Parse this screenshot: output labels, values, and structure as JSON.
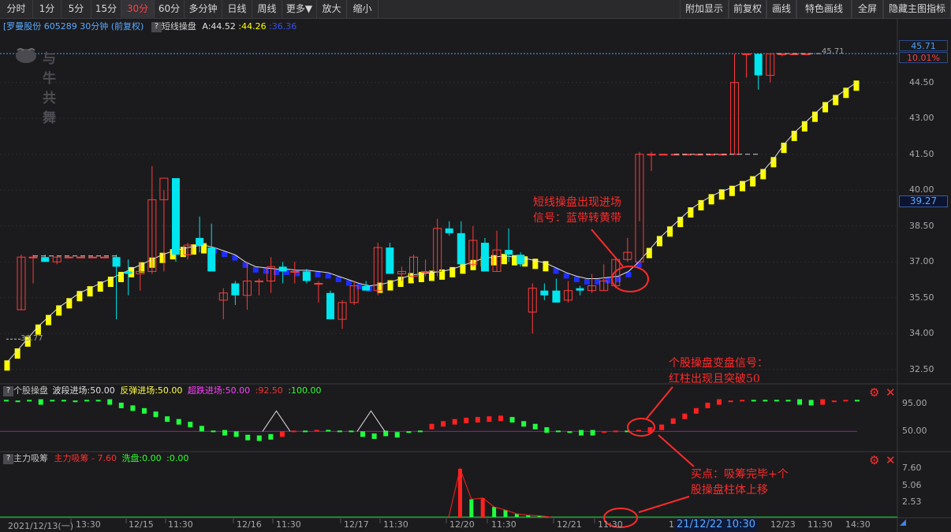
{
  "toolbar": {
    "left": [
      "分时",
      "1分",
      "5分",
      "15分",
      "30分",
      "60分",
      "多分钟",
      "日线",
      "周线",
      "更多▼",
      "放大",
      "缩小"
    ],
    "right": [
      "附加显示",
      "前复权",
      "画线",
      "特色画线",
      "全屏",
      "隐藏主图指标"
    ],
    "active": "30分"
  },
  "main_header": {
    "stock": "[罗曼股份 605289 30分钟 (前复权)",
    "indicator": "短线操盘",
    "a_value": "A:44.52",
    "yellow_value": ":44.26",
    "blue_value": ":36.36"
  },
  "logo_text": "与牛共舞",
  "price_axis": {
    "ticks": [
      "45.71",
      "44.50",
      "43.00",
      "41.50",
      "40.00",
      "38.50",
      "37.00",
      "35.50",
      "34.00",
      "32.50"
    ],
    "top_price": "45.71",
    "top_pct": "10.01%",
    "current": "39.27",
    "prev_close_marker": "33.77",
    "high_marker": "45.71"
  },
  "sub1_header": {
    "name": "个股操盘",
    "l1": "波段进场:50.00",
    "l2": "反弹进场:50.00",
    "l3": "超跌进场:50.00",
    "l4": ":92.50",
    "l5": ":100.00",
    "ticks": [
      "95.00",
      "50.00"
    ]
  },
  "sub2_header": {
    "name": "主力吸筹",
    "l1": "主力吸筹 - 7.60",
    "l2": "洗盘:0.00",
    "l3": ":0.00",
    "ticks": [
      "7.60",
      "5.06",
      "2.53"
    ]
  },
  "time_axis": [
    "2021/12/13(一)",
    "13:30",
    "12/15",
    "11:30",
    "12/16",
    "11:30",
    "12/17",
    "11:30",
    "12/20",
    "11:30",
    "12/21",
    "11:30",
    "12",
    "12/23",
    "11:30",
    "14:30"
  ],
  "time_highlight": "21/12/22 10:30",
  "annotations": {
    "a1_line1": "短线操盘出现进场",
    "a1_line2": "信号：蓝带转黄带",
    "a2_line1": "个股操盘变盘信号：",
    "a2_line2": "红柱出现且突破50",
    "a3_line1": "买点：吸筹完毕+个",
    "a3_line2": "股操盘柱体上移"
  },
  "colors": {
    "up": "#ff3b3b",
    "down": "#00e5ee",
    "yellow_band": "#ffff00",
    "blue_band": "#1e2eff",
    "annotation": "#ff2a2a",
    "magenta_line": "#c000c0"
  },
  "chart_data": {
    "type": "candlestick",
    "ylim": [
      32.0,
      46.5
    ],
    "candles": [
      {
        "o": 35.0,
        "h": 37.3,
        "l": 35.0,
        "c": 37.2
      },
      {
        "o": 37.2,
        "h": 37.3,
        "l": 36.1,
        "c": 37.2
      },
      {
        "o": 37.2,
        "h": 37.3,
        "l": 37.0,
        "c": 37.0
      },
      {
        "o": 37.0,
        "h": 37.2,
        "l": 36.9,
        "c": 37.2
      },
      {
        "o": 37.2,
        "h": 37.2,
        "l": 37.2,
        "c": 37.2
      },
      {
        "o": 37.2,
        "h": 37.2,
        "l": 37.2,
        "c": 37.2
      },
      {
        "o": 37.2,
        "h": 37.2,
        "l": 37.2,
        "c": 37.2
      },
      {
        "o": 37.2,
        "h": 37.2,
        "l": 37.2,
        "c": 37.2
      },
      {
        "o": 37.2,
        "h": 37.3,
        "l": 34.6,
        "c": 36.8
      },
      {
        "o": 36.6,
        "h": 37.1,
        "l": 35.6,
        "c": 36.5
      },
      {
        "o": 36.5,
        "h": 37.0,
        "l": 35.8,
        "c": 36.6
      },
      {
        "o": 36.6,
        "h": 41.0,
        "l": 36.5,
        "c": 39.6
      },
      {
        "o": 39.6,
        "h": 40.0,
        "l": 36.6,
        "c": 40.5
      },
      {
        "o": 40.5,
        "h": 40.5,
        "l": 37.0,
        "c": 37.3
      },
      {
        "o": 37.3,
        "h": 37.8,
        "l": 37.1,
        "c": 37.7
      },
      {
        "o": 38.0,
        "h": 38.9,
        "l": 37.4,
        "c": 37.7
      },
      {
        "o": 37.6,
        "h": 38.6,
        "l": 36.8,
        "c": 36.6
      },
      {
        "o": 35.4,
        "h": 35.9,
        "l": 34.6,
        "c": 35.7
      },
      {
        "o": 36.1,
        "h": 36.2,
        "l": 35.2,
        "c": 35.6
      },
      {
        "o": 35.6,
        "h": 37.0,
        "l": 35.0,
        "c": 36.2
      },
      {
        "o": 36.2,
        "h": 36.3,
        "l": 35.6,
        "c": 36.2
      },
      {
        "o": 36.2,
        "h": 37.2,
        "l": 35.7,
        "c": 36.8
      },
      {
        "o": 36.8,
        "h": 37.0,
        "l": 36.1,
        "c": 36.6
      },
      {
        "o": 36.6,
        "h": 37.0,
        "l": 36.1,
        "c": 36.6
      },
      {
        "o": 36.6,
        "h": 36.7,
        "l": 36.1,
        "c": 36.2
      },
      {
        "o": 36.1,
        "h": 36.2,
        "l": 35.3,
        "c": 36.1
      },
      {
        "o": 35.7,
        "h": 35.8,
        "l": 34.6,
        "c": 34.6
      },
      {
        "o": 34.6,
        "h": 35.4,
        "l": 34.2,
        "c": 35.3
      },
      {
        "o": 35.3,
        "h": 36.2,
        "l": 35.2,
        "c": 36.0
      },
      {
        "o": 36.0,
        "h": 36.2,
        "l": 35.8,
        "c": 35.8
      },
      {
        "o": 35.8,
        "h": 37.8,
        "l": 35.6,
        "c": 37.6
      },
      {
        "o": 37.6,
        "h": 37.8,
        "l": 36.5,
        "c": 36.5
      },
      {
        "o": 36.5,
        "h": 36.8,
        "l": 36.2,
        "c": 36.6
      },
      {
        "o": 36.4,
        "h": 37.3,
        "l": 36.2,
        "c": 37.2
      },
      {
        "o": 36.6,
        "h": 37.1,
        "l": 36.4,
        "c": 36.6
      },
      {
        "o": 36.6,
        "h": 38.8,
        "l": 36.4,
        "c": 38.4
      },
      {
        "o": 38.4,
        "h": 38.7,
        "l": 38.1,
        "c": 38.2
      },
      {
        "o": 38.2,
        "h": 38.7,
        "l": 36.9,
        "c": 36.9
      },
      {
        "o": 36.9,
        "h": 38.5,
        "l": 36.8,
        "c": 37.9
      },
      {
        "o": 37.8,
        "h": 38.0,
        "l": 36.8,
        "c": 36.6
      },
      {
        "o": 36.6,
        "h": 38.3,
        "l": 36.6,
        "c": 37.5
      },
      {
        "o": 37.5,
        "h": 38.4,
        "l": 37.0,
        "c": 37.3
      },
      {
        "o": 37.3,
        "h": 37.4,
        "l": 36.8,
        "c": 36.9
      },
      {
        "o": 34.9,
        "h": 36.1,
        "l": 34.0,
        "c": 35.9
      },
      {
        "o": 35.8,
        "h": 36.1,
        "l": 35.4,
        "c": 35.6
      },
      {
        "o": 35.8,
        "h": 36.3,
        "l": 35.3,
        "c": 35.3
      },
      {
        "o": 35.4,
        "h": 36.2,
        "l": 35.3,
        "c": 35.8
      },
      {
        "o": 35.9,
        "h": 36.0,
        "l": 35.6,
        "c": 35.8
      },
      {
        "o": 35.8,
        "h": 36.5,
        "l": 35.7,
        "c": 36.0
      },
      {
        "o": 35.8,
        "h": 36.9,
        "l": 35.8,
        "c": 36.2
      },
      {
        "o": 36.0,
        "h": 37.2,
        "l": 35.9,
        "c": 37.1
      },
      {
        "o": 37.1,
        "h": 38.0,
        "l": 37.0,
        "c": 37.4
      },
      {
        "o": 37.0,
        "h": 41.6,
        "l": 38.7,
        "c": 41.5
      },
      {
        "o": 41.5,
        "h": 41.6,
        "l": 40.8,
        "c": 41.5
      },
      {
        "o": 41.5,
        "h": 41.5,
        "l": 41.5,
        "c": 41.5
      },
      {
        "o": 41.5,
        "h": 41.5,
        "l": 41.5,
        "c": 41.5
      },
      {
        "o": 41.5,
        "h": 41.5,
        "l": 41.5,
        "c": 41.5
      },
      {
        "o": 41.5,
        "h": 41.5,
        "l": 41.5,
        "c": 41.5
      },
      {
        "o": 41.5,
        "h": 41.5,
        "l": 41.5,
        "c": 41.5
      },
      {
        "o": 41.5,
        "h": 41.5,
        "l": 41.5,
        "c": 41.5
      },
      {
        "o": 41.5,
        "h": 45.7,
        "l": 41.5,
        "c": 44.5
      },
      {
        "o": 45.7,
        "h": 45.7,
        "l": 44.7,
        "c": 45.7
      },
      {
        "o": 45.7,
        "h": 45.7,
        "l": 44.2,
        "c": 44.8
      },
      {
        "o": 44.8,
        "h": 45.7,
        "l": 44.5,
        "c": 45.7
      },
      {
        "o": 45.7,
        "h": 45.7,
        "l": 45.6,
        "c": 45.7
      },
      {
        "o": 45.7,
        "h": 45.7,
        "l": 45.7,
        "c": 45.7
      },
      {
        "o": 45.7,
        "h": 45.7,
        "l": 45.7,
        "c": 45.7
      }
    ],
    "band": [
      32.8,
      33.3,
      33.8,
      34.3,
      34.7,
      35.1,
      35.4,
      35.7,
      35.9,
      36.1,
      36.3,
      36.5,
      36.7,
      36.9,
      37.1,
      37.3,
      37.45,
      37.55,
      37.65,
      37.7,
      37.6,
      37.45,
      37.3,
      37.0,
      36.8,
      36.75,
      36.7,
      36.7,
      36.65,
      36.65,
      36.6,
      36.55,
      36.4,
      36.25,
      36.1,
      36.0,
      36.05,
      36.15,
      36.3,
      36.45,
      36.5,
      36.55,
      36.6,
      36.7,
      36.85,
      37.0,
      37.15,
      37.2,
      37.25,
      37.2,
      37.15,
      37.05,
      36.95,
      36.75,
      36.55,
      36.4,
      36.3,
      36.3,
      36.35,
      36.4,
      36.6,
      37.0,
      37.5,
      38.0,
      38.4,
      38.8,
      39.2,
      39.5,
      39.75,
      39.95,
      40.1,
      40.3,
      40.5,
      40.8,
      41.3,
      41.9,
      42.4,
      42.8,
      43.2,
      43.6,
      43.9,
      44.2,
      44.5
    ],
    "band_colors": "yyyyyyyyyyyyyyyyyyyybbbbbbbbbbbbbbbbyyyyyyyyyyyyyyyyybbbbbbbbbyyyyyyyyyyyyyyyyyyyyyyy",
    "osc": [
      95,
      94,
      95,
      93,
      95,
      95,
      94,
      95,
      95,
      93,
      88,
      84,
      80,
      75,
      68,
      64,
      60,
      54,
      50,
      48,
      46,
      41,
      40,
      42,
      46,
      50,
      50,
      51,
      51,
      50,
      50,
      46,
      43,
      47,
      45,
      49,
      50,
      57,
      61,
      64,
      66,
      67,
      68,
      69,
      67,
      61,
      57,
      52,
      50,
      49,
      48,
      48,
      49,
      50,
      50,
      51,
      52,
      56,
      65,
      72,
      80,
      88,
      93,
      94,
      95,
      95,
      95,
      95,
      95,
      93,
      92,
      93,
      94,
      95,
      95
    ],
    "accum": [
      0,
      0,
      0,
      0,
      0,
      0,
      0,
      0,
      0,
      0,
      0,
      0,
      0,
      0,
      0,
      0,
      0,
      0,
      0,
      0,
      0,
      0,
      0,
      0,
      0,
      0,
      0,
      0,
      0,
      0,
      0,
      0,
      0,
      0,
      0,
      0,
      0,
      0,
      0,
      0,
      7.6,
      2.8,
      3.0,
      1.6,
      1.1,
      0.5,
      0.3,
      0.2,
      0,
      0,
      0,
      0,
      0,
      0,
      0,
      0,
      0,
      0,
      0,
      0,
      0,
      0,
      0,
      0,
      0,
      0,
      0,
      0,
      0,
      0,
      0,
      0,
      0,
      0,
      0,
      0
    ]
  }
}
